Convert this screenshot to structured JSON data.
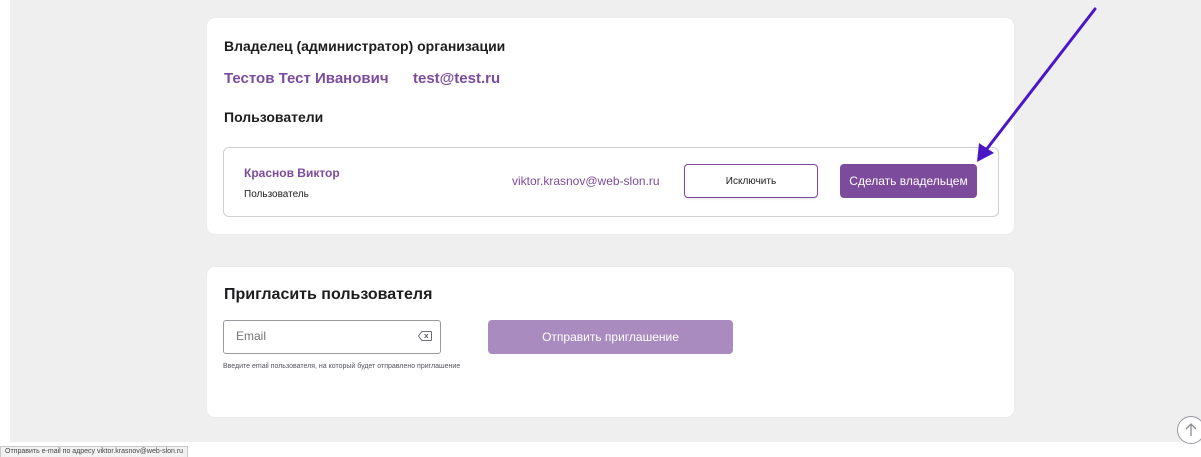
{
  "owner_card": {
    "heading": "Владелец (администратор) организации",
    "owner_name": "Тестов Тест Иванович",
    "owner_email": "test@test.ru",
    "users_heading": "Пользователи",
    "users": [
      {
        "name": "Краснов Виктор",
        "role": "Пользователь",
        "email": "viktor.krasnov@web-slon.ru",
        "exclude_label": "Исключить",
        "make_owner_label": "Сделать владельцем"
      }
    ]
  },
  "invite_card": {
    "heading": "Пригласить пользователя",
    "email_placeholder": "Email",
    "email_value": "",
    "hint": "Введите email пользователя, на который будет отправлено приглашение",
    "send_label": "Отправить приглашение"
  },
  "status_bar": {
    "text": "Отправить e-mail по адресу viktor.krasnov@web-slon.ru"
  },
  "colors": {
    "accent": "#7d4b9c",
    "accent_disabled": "#a98bbf",
    "annotation_arrow": "#4b16c8",
    "page_background": "#efeff0"
  },
  "icons": {
    "clear_input": "backspace-clear-icon",
    "scroll_top": "arrow-up-circle-icon",
    "annotation": "arrow-annotation"
  }
}
